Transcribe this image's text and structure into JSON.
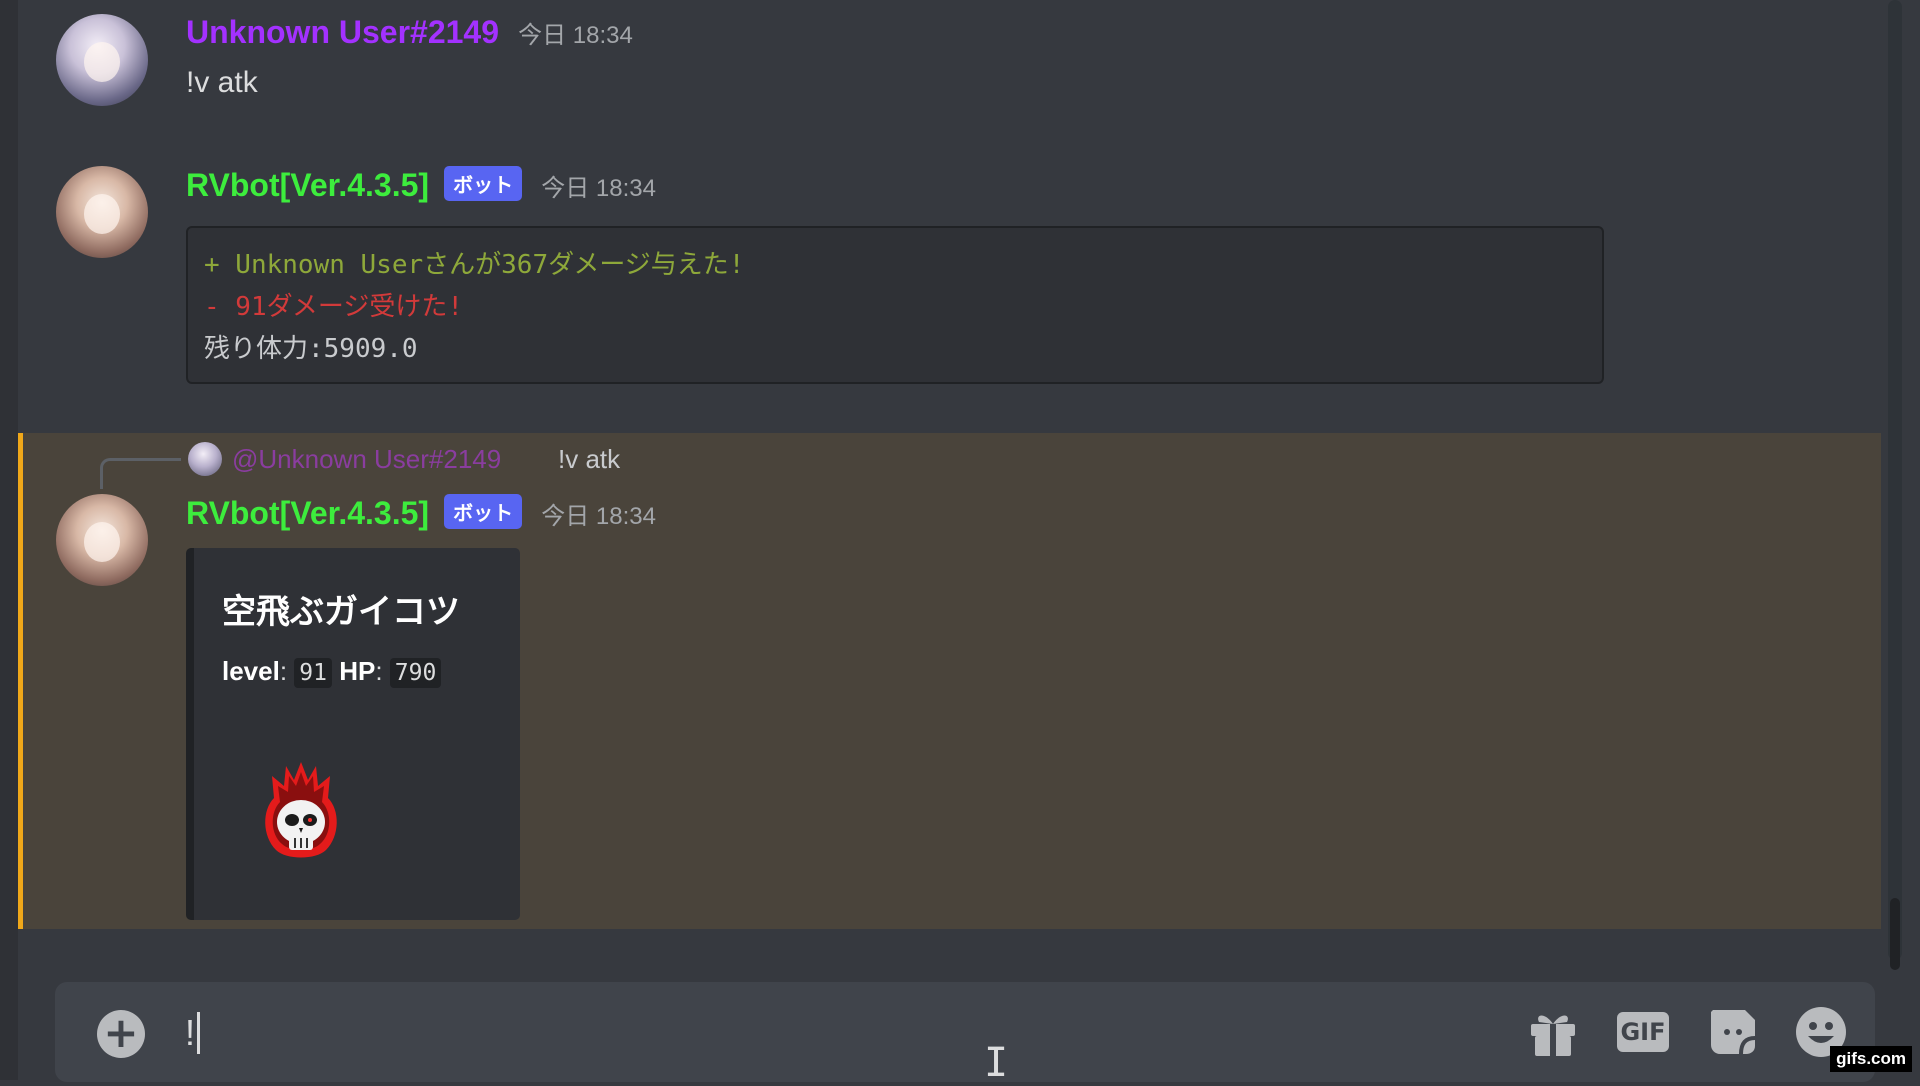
{
  "messages": [
    {
      "author": "Unknown User#2149",
      "author_color": "#a331ff",
      "timestamp": "今日 18:34",
      "content": "!v atk"
    },
    {
      "author": "RVbot[Ver.4.3.5]",
      "author_color": "#3ded3d",
      "badge": "ボット",
      "timestamp": "今日 18:34",
      "code_lines": [
        "+ Unknown Userさんが367ダメージ与えた!",
        "- 91ダメージ受けた!",
        "残り体力:5909.0"
      ]
    },
    {
      "reply": {
        "mention": "@Unknown User#2149",
        "text": "!v atk"
      },
      "author": "RVbot[Ver.4.3.5]",
      "author_color": "#3ded3d",
      "badge": "ボット",
      "timestamp": "今日 18:34",
      "embed": {
        "title": "空飛ぶガイコツ",
        "level_label": "level",
        "level_value": "91",
        "hp_label": "HP",
        "hp_value": "790",
        "image_icon": "flaming-skull-icon"
      }
    }
  ],
  "composer": {
    "text": "!",
    "gif_label": "GIF",
    "icons": [
      "add-icon",
      "gift-icon",
      "gif-icon",
      "sticker-icon",
      "emoji-icon"
    ]
  },
  "watermark": "gifs.com",
  "colors": {
    "background": "#36393f",
    "highlight": "#4a443b",
    "highlight_border": "#f0a81a",
    "bot_badge": "#5865f2"
  }
}
